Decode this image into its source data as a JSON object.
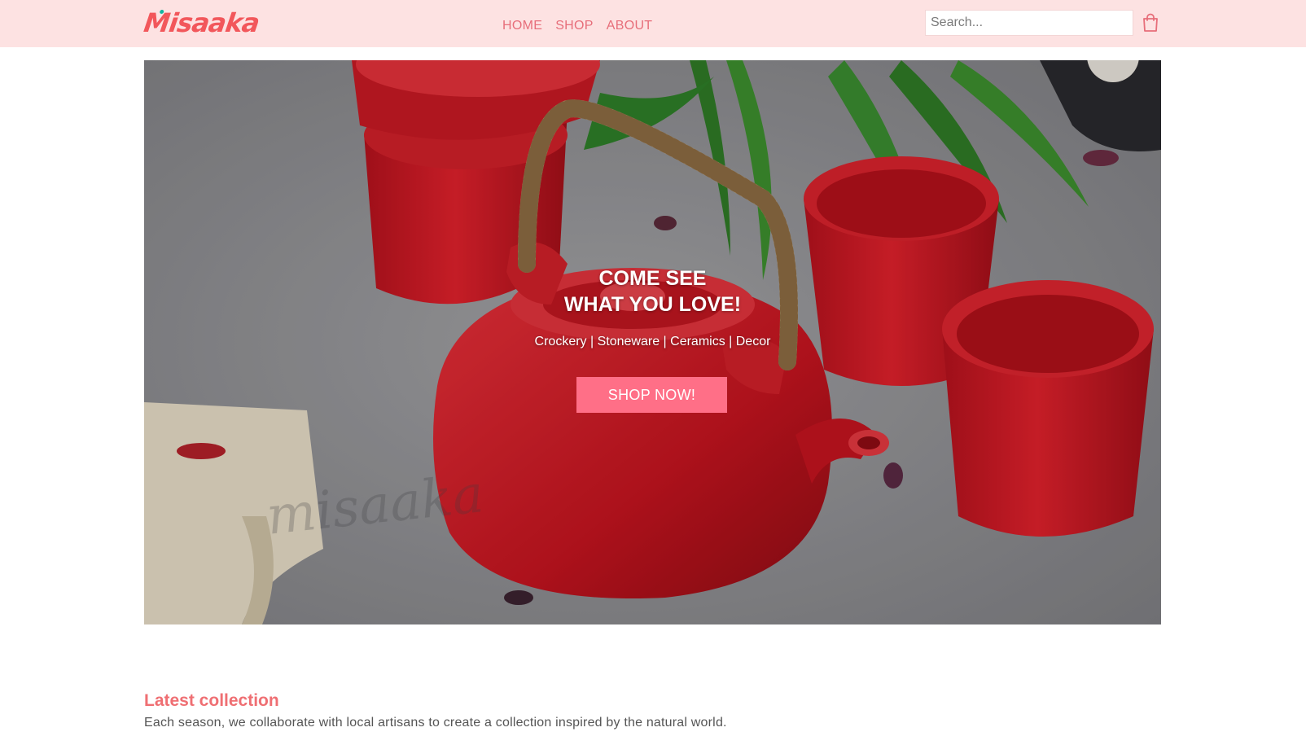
{
  "brand": {
    "logo_text": "Misaaka",
    "logo_color": "#f2575b",
    "accent_dot_color": "#12b5a0"
  },
  "nav": {
    "links": [
      {
        "label": "HOME"
      },
      {
        "label": "SHOP"
      },
      {
        "label": "ABOUT"
      }
    ],
    "link_color": "#e76e7a",
    "background": "#fde2e2"
  },
  "search": {
    "placeholder": "Search...",
    "value": ""
  },
  "cart": {
    "icon": "shopping-bag-icon"
  },
  "hero": {
    "title_line1": "COME SEE",
    "title_line2": "WHAT YOU LOVE!",
    "subtitle": "Crockery | Stoneware | Ceramics | Decor",
    "cta_label": "SHOP NOW!",
    "cta_color": "#ff6f87",
    "image": "red-teapot-and-cups-photo",
    "watermark": "misaaka"
  },
  "latest": {
    "title": "Latest collection",
    "description": "Each season, we collaborate with local artisans to create a collection inspired by the natural world."
  }
}
